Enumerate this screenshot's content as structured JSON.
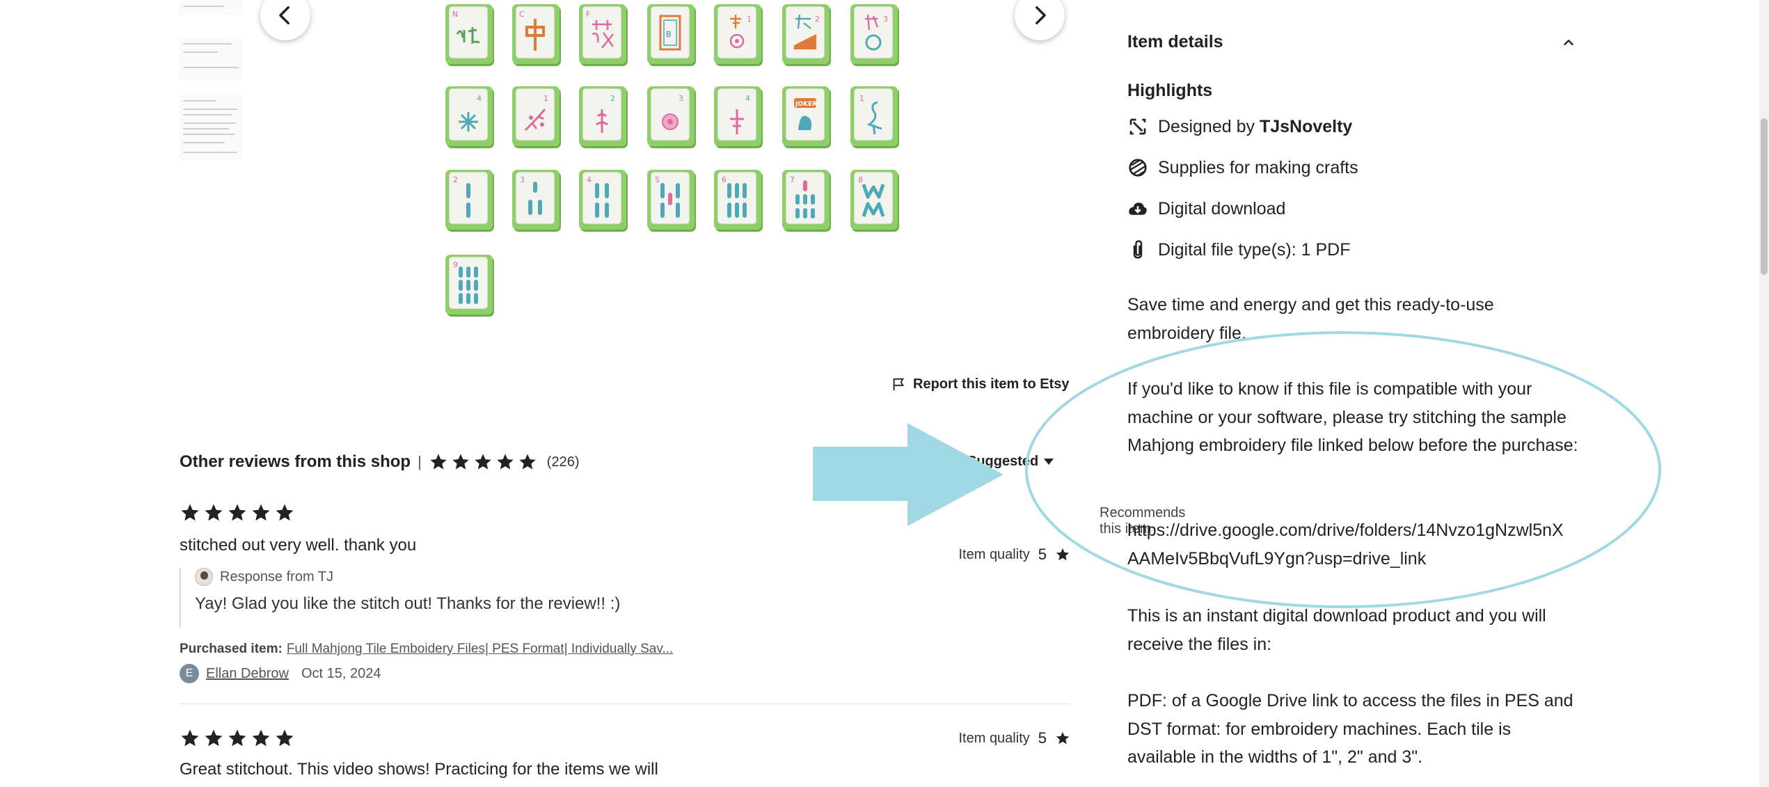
{
  "gallery": {
    "prev_icon": "chevron-left-icon",
    "next_icon": "chevron-right-icon",
    "tile_corner_marks": [
      "N",
      "C",
      "F",
      "",
      "1",
      "2",
      "3",
      "4",
      "1",
      "2",
      "3",
      "4",
      "",
      "1",
      "2",
      "3",
      "4",
      "5",
      "6",
      "7",
      "8",
      "9"
    ]
  },
  "report": {
    "label": "Report this item to Etsy",
    "icon": "flag-icon"
  },
  "reviews": {
    "title": "Other reviews from this shop",
    "separator": "|",
    "rating": 5,
    "count": "(226)",
    "sort_label": "Suggested",
    "recommends": "Recommends this item",
    "items": [
      {
        "rating": 5,
        "text": "stitched out very well. thank you",
        "quality_label": "Item quality",
        "quality_value": "5",
        "response_by": "Response from TJ",
        "response_text": "Yay! Glad you like the stitch out! Thanks for the review!! :)",
        "purchased_label": "Purchased item:",
        "purchased_item": "Full Mahjong Tile Emboidery Files| PES Format| Individually Sav...",
        "reviewer_initial": "E",
        "reviewer_name": "Ellan Debrow",
        "date": "Oct 15, 2024"
      },
      {
        "rating": 5,
        "text": "Great stitchout. This video shows! Practicing for the items we will",
        "quality_label": "Item quality",
        "quality_value": "5"
      }
    ]
  },
  "details": {
    "header": "Item details",
    "highlights_title": "Highlights",
    "designed_by_prefix": "Designed by",
    "designer": "TJsNovelty",
    "supplies": "Supplies for making crafts",
    "download": "Digital download",
    "file_types": "Digital file type(s): 1 PDF",
    "para1": "Save time and energy and get this ready-to-use embroidery file.",
    "para2": "If you'd like to know if this file is compatible with your machine or your software, please try stitching the sample Mahjong embroidery file linked below before the purchase:",
    "link": "https://drive.google.com/drive/folders/14Nvzo1gNzwl5nXAAMeIv5BbqVufL9Ygn?usp=drive_link",
    "para3": "This is an instant digital download product and you will receive the files in:",
    "para4": "PDF: of a Google Drive link to access the files in PES and DST format: for embroidery machines. Each tile is available in the widths of 1\", 2\" and 3\"."
  },
  "colors": {
    "annotation": "#a0d8e4",
    "tile_green": "#8fcf6a",
    "star": "#222222"
  }
}
